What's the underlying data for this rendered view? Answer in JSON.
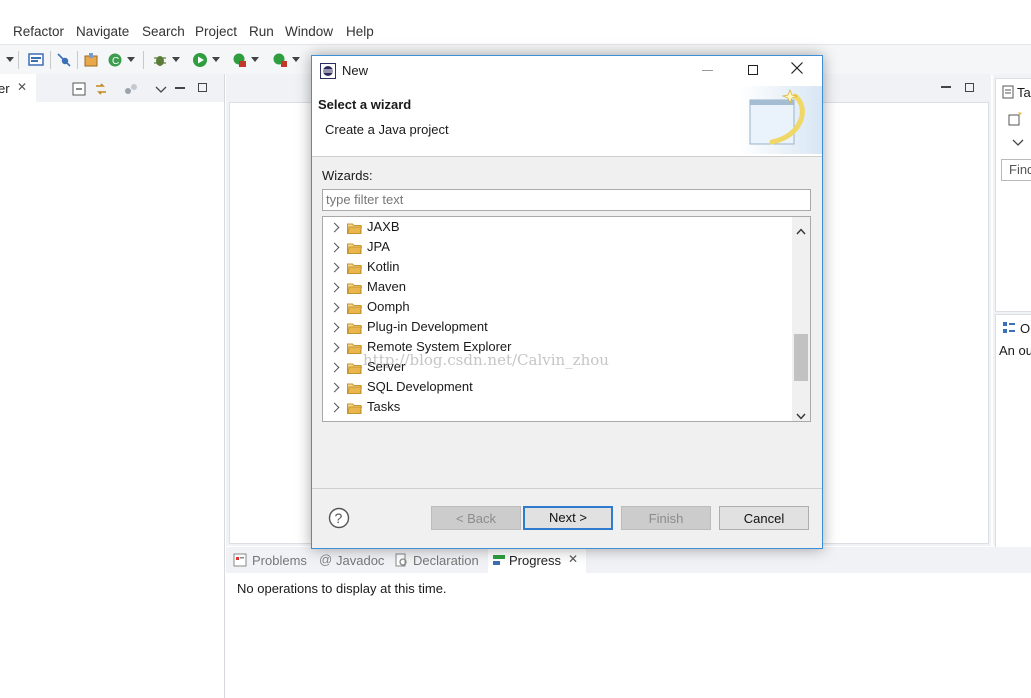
{
  "menubar": {
    "items": [
      "Refactor",
      "Navigate",
      "Search",
      "Project",
      "Run",
      "Window",
      "Help"
    ]
  },
  "left_view": {
    "tab_label": "er"
  },
  "right_views": {
    "tasks_tab": "Ta",
    "find_field": "Find",
    "outline_tab": "Ou",
    "outline_text": "An ou"
  },
  "bottom_view": {
    "tabs": [
      {
        "label": "Problems",
        "icon": "problems-icon"
      },
      {
        "label": "Javadoc",
        "icon": "at-icon"
      },
      {
        "label": "Declaration",
        "icon": "declaration-icon"
      },
      {
        "label": "Progress",
        "icon": "progress-icon"
      }
    ],
    "message": "No operations to display at this time."
  },
  "dialog": {
    "title": "New",
    "heading": "Select a wizard",
    "description": "Create a Java project",
    "wizards_label": "Wizards:",
    "filter_placeholder": "type filter text",
    "tree_items": [
      "JAXB",
      "JPA",
      "Kotlin",
      "Maven",
      "Oomph",
      "Plug-in Development",
      "Remote System Explorer",
      "Server",
      "SQL Development",
      "Tasks"
    ],
    "watermark": "http://blog.csdn.net/Calvin_zhou",
    "buttons": {
      "back": "< Back",
      "next": "Next >",
      "finish": "Finish",
      "cancel": "Cancel"
    }
  },
  "colors": {
    "accent": "#3f8fd6",
    "folder": "#e8b64d",
    "dialog_bg": "#f0f0f0",
    "pane_bg": "#f0f2f5"
  }
}
